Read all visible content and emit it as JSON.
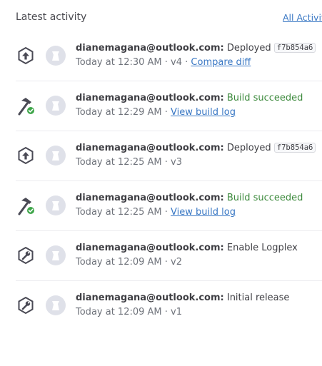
{
  "header": {
    "title": "Latest activity",
    "all_link": "All Activity"
  },
  "items": [
    {
      "email": "dianemagana@outlook.com:",
      "description": "Deployed",
      "sha": "f7b854a6",
      "time": "Today at 12:30 AM",
      "version": "v4",
      "link": "Compare diff",
      "icon": "deploy-icon"
    },
    {
      "email": "dianemagana@outlook.com:",
      "description": "Build succeeded",
      "time": "Today at 12:29 AM",
      "link": "View build log",
      "icon": "build-success-icon"
    },
    {
      "email": "dianemagana@outlook.com:",
      "description": "Deployed",
      "sha": "f7b854a6",
      "time": "Today at 12:25 AM",
      "version": "v3",
      "icon": "deploy-icon"
    },
    {
      "email": "dianemagana@outlook.com:",
      "description": "Build succeeded",
      "time": "Today at 12:25 AM",
      "link": "View build log",
      "icon": "build-success-icon"
    },
    {
      "email": "dianemagana@outlook.com:",
      "description": "Enable Logplex",
      "time": "Today at 12:09 AM",
      "version": "v2",
      "icon": "config-icon"
    },
    {
      "email": "dianemagana@outlook.com:",
      "description": "Initial release",
      "time": "Today at 12:09 AM",
      "version": "v1",
      "icon": "config-icon"
    }
  ],
  "colors": {
    "link": "#3a78c4",
    "success": "#3d8a3d",
    "icon": "#4a4a55",
    "check": "#3fa64a",
    "avatar": "#dfe1e9"
  }
}
